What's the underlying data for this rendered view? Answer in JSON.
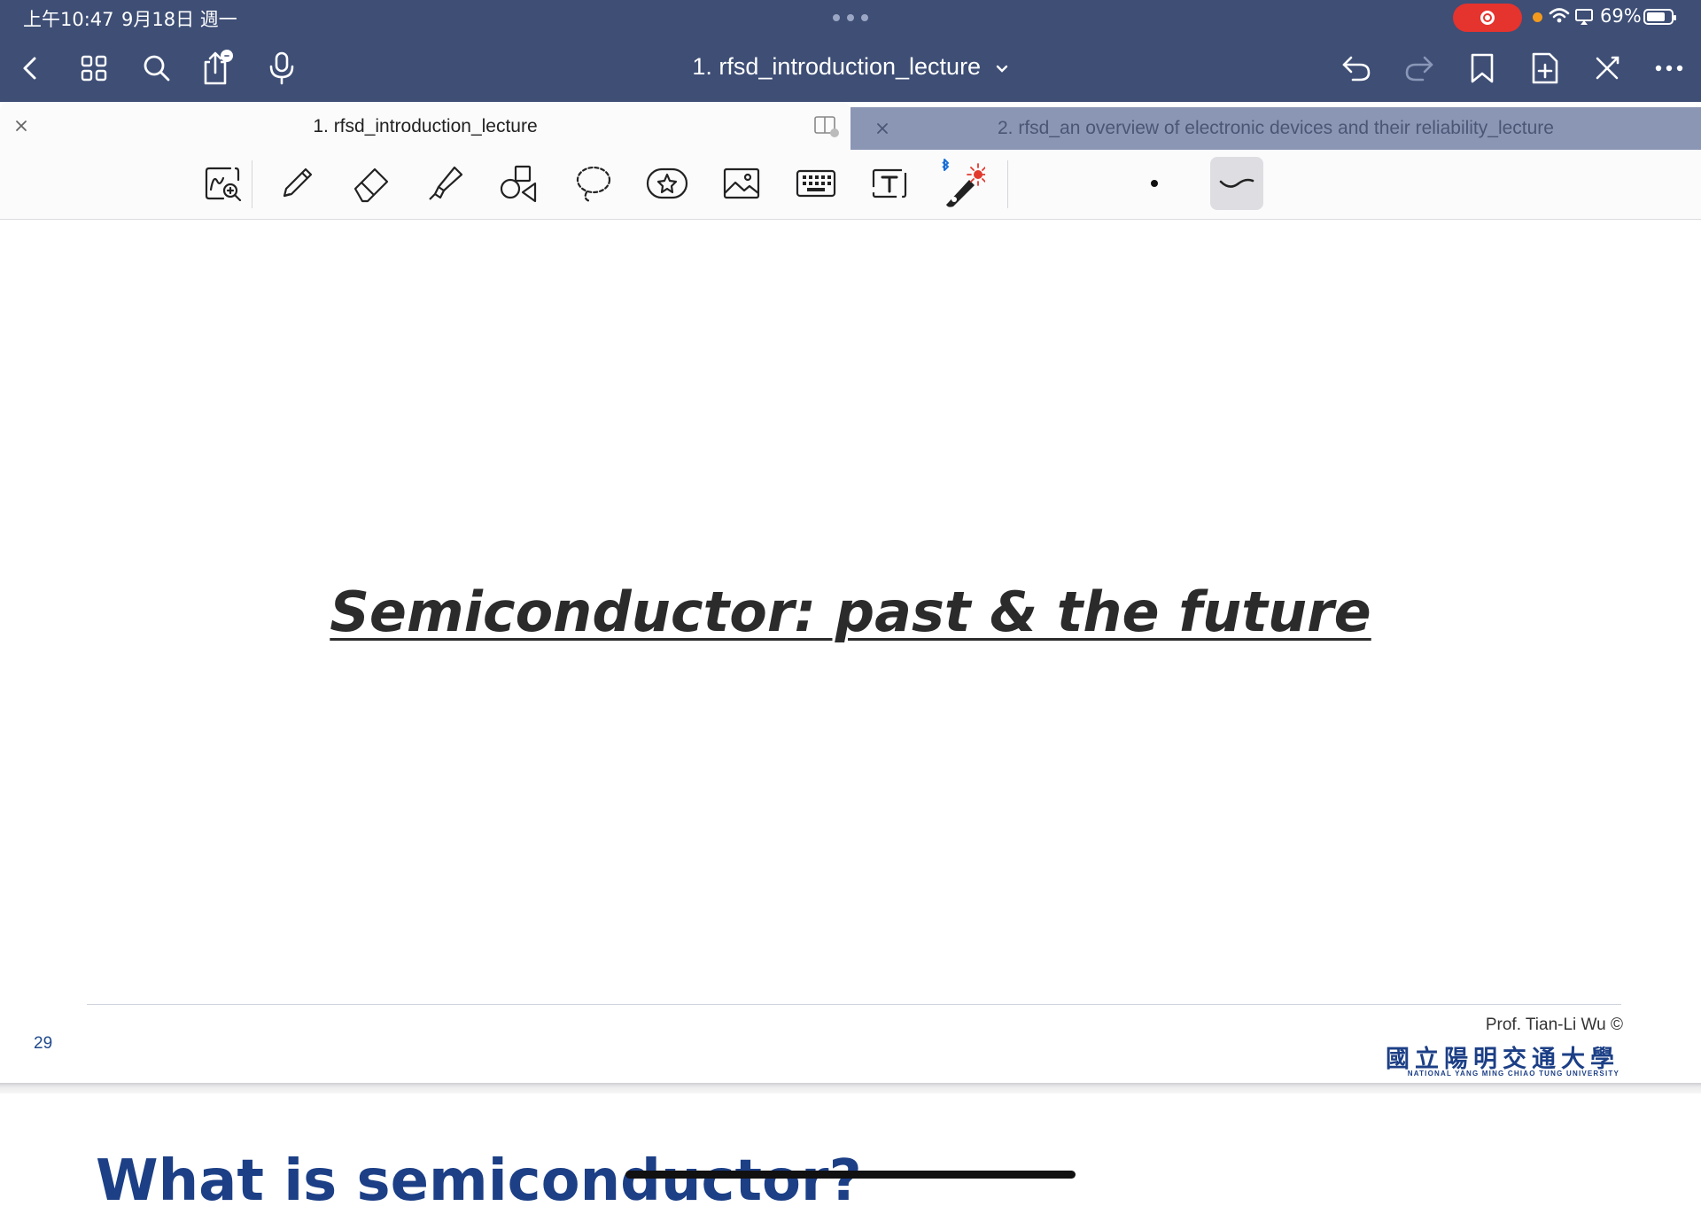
{
  "status_bar": {
    "time": "上午10:47",
    "date": "9月18日 週一",
    "battery_percent": "69%",
    "recording": true
  },
  "nav": {
    "document_title": "1. rfsd_introduction_lecture",
    "icons": [
      "back-icon",
      "grid-icon",
      "search-icon",
      "share-icon",
      "microphone-icon",
      "undo-icon",
      "redo-icon",
      "bookmark-icon",
      "add-page-icon",
      "close-toolbar-icon",
      "more-icon"
    ]
  },
  "tabs": [
    {
      "label": "1. rfsd_introduction_lecture",
      "active": true
    },
    {
      "label": "2. rfsd_an overview of electronic devices and their reliability_lecture",
      "active": false
    }
  ],
  "toolbar": {
    "tools": [
      "zoom-window",
      "pen",
      "eraser",
      "highlighter",
      "shapes",
      "lasso",
      "elements",
      "image",
      "keyboard",
      "text-box",
      "laser-pointer"
    ],
    "selected": "stroke-style"
  },
  "slide": {
    "title": "Semiconductor: past & the future",
    "page_number": "29",
    "author": "Prof. Tian-Li Wu ©",
    "university_zh": "國立陽明交通大學",
    "university_en": "NATIONAL YANG MING CHIAO TUNG UNIVERSITY"
  },
  "next_slide": {
    "title_partial": "What is semiconductor?"
  },
  "colors": {
    "nav_bg": "#3e4e75",
    "inactive_tab_bg": "#8b96b4",
    "brand_blue": "#1c3f86",
    "record_red": "#e5332e"
  }
}
